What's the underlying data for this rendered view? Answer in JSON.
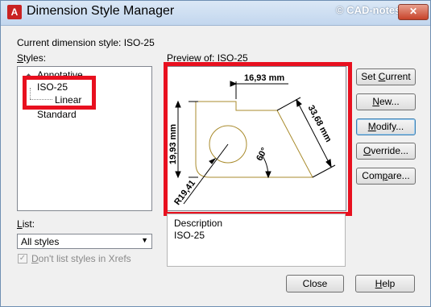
{
  "window": {
    "title": "Dimension Style Manager",
    "watermark": "© CAD-notes.com",
    "close_glyph": "✕",
    "app_icon_letter": "A",
    "app_icon": "autocad-app-icon"
  },
  "current_style": {
    "label": "Current dimension style: ISO-25"
  },
  "styles": {
    "label_prefix": "S",
    "label_rest": "tyles:",
    "items": [
      {
        "label": "Annotative",
        "icon": "annotative-icon",
        "glyph": "◆"
      },
      {
        "label": "ISO-25"
      },
      {
        "label": "Linear"
      },
      {
        "label": "Standard"
      }
    ]
  },
  "preview": {
    "label": "Preview of: ISO-25",
    "dims": {
      "top": "16,93 mm",
      "left": "19,93 mm",
      "right": "33,68 mm",
      "angle": "60°",
      "radius": "R19,41"
    }
  },
  "description": {
    "label": "Description",
    "value": "ISO-25"
  },
  "list": {
    "label_prefix": "L",
    "label_rest": "ist:",
    "selected": "All styles",
    "arrow": "▼"
  },
  "checkbox": {
    "label_prefix": "D",
    "label_rest": "on't list styles in Xrefs",
    "checked": true,
    "glyph": "✓"
  },
  "buttons": {
    "set_current": {
      "pre": "Set ",
      "ul": "C",
      "post": "urrent"
    },
    "new": {
      "pre": "",
      "ul": "N",
      "post": "ew..."
    },
    "modify": {
      "pre": "",
      "ul": "M",
      "post": "odify..."
    },
    "override": {
      "pre": "",
      "ul": "O",
      "post": "verride..."
    },
    "compare": {
      "pre": "Com",
      "ul": "p",
      "post": "are..."
    },
    "close": {
      "label": "Close"
    },
    "help": {
      "pre": "",
      "ul": "H",
      "post": "elp"
    }
  },
  "colors": {
    "highlight_red": "#e8101f",
    "preview_line": "#a98b2c",
    "title_bar": "#c2d6ee"
  }
}
